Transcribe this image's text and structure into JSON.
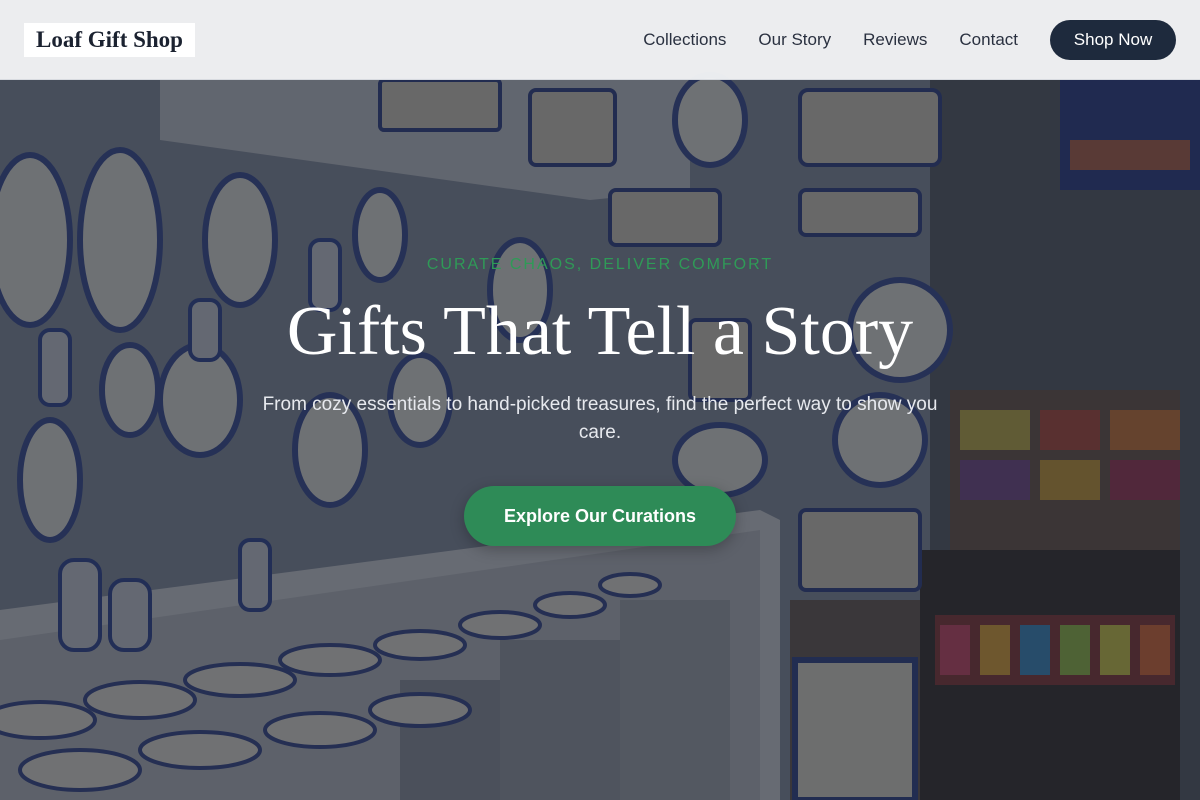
{
  "nav": {
    "brand": "Loaf Gift Shop",
    "links": [
      "Collections",
      "Our Story",
      "Reviews",
      "Contact"
    ],
    "cta_label": "Shop Now"
  },
  "hero": {
    "eyebrow": "CURATE CHAOS, DELIVER COMFORT",
    "headline": "Gifts That Tell a Story",
    "subtext": "From cozy essentials to hand-picked treasures, find the perfect way to show you care.",
    "cta_label": "Explore Our Curations"
  },
  "colors": {
    "accent_green": "#2e8b57",
    "nav_button": "#1e2a3d",
    "nav_background": "#f3f4f6"
  }
}
